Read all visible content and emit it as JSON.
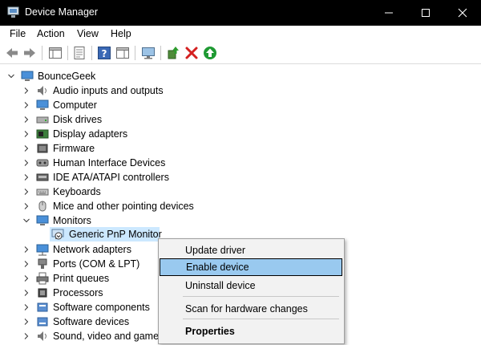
{
  "window": {
    "title": "Device Manager"
  },
  "menu": [
    "File",
    "Action",
    "View",
    "Help"
  ],
  "tree": {
    "root": "BounceGeek",
    "items": [
      "Audio inputs and outputs",
      "Computer",
      "Disk drives",
      "Display adapters",
      "Firmware",
      "Human Interface Devices",
      "IDE ATA/ATAPI controllers",
      "Keyboards",
      "Mice and other pointing devices",
      "Monitors",
      "Generic PnP Monitor",
      "Network adapters",
      "Ports (COM & LPT)",
      "Print queues",
      "Processors",
      "Software components",
      "Software devices",
      "Sound, video and game c"
    ]
  },
  "context_menu": {
    "items": [
      "Update driver",
      "Enable device",
      "Uninstall device",
      "Scan for hardware changes",
      "Properties"
    ]
  },
  "colors": {
    "selection": "#cce8ff",
    "menu_highlight": "#99c9ef",
    "titlebar": "#000000"
  }
}
